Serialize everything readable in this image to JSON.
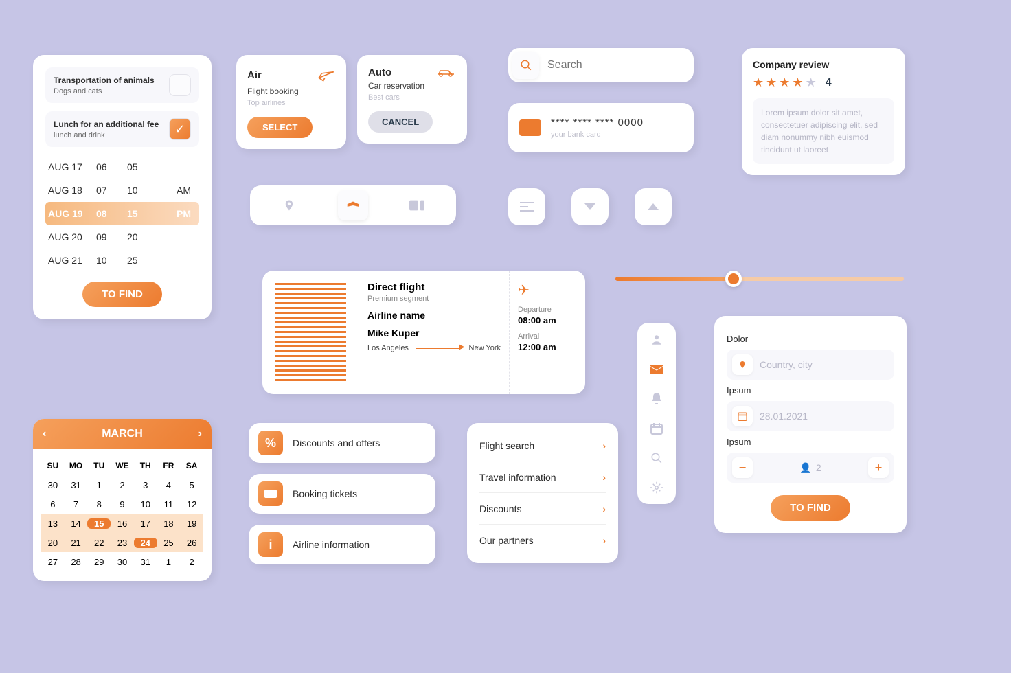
{
  "options_panel": {
    "item1": {
      "title": "Transportation of animals",
      "subtitle": "Dogs and cats"
    },
    "item2": {
      "title": "Lunch for an additional fee",
      "subtitle": "lunch and drink"
    },
    "time_rows": [
      {
        "date": "AUG 17",
        "h": "06",
        "m": "05",
        "ampm": ""
      },
      {
        "date": "AUG 18",
        "h": "07",
        "m": "10",
        "ampm": "AM"
      },
      {
        "date": "AUG 19",
        "h": "08",
        "m": "15",
        "ampm": "PM"
      },
      {
        "date": "AUG 20",
        "h": "09",
        "m": "20",
        "ampm": ""
      },
      {
        "date": "AUG 21",
        "h": "10",
        "m": "25",
        "ampm": ""
      }
    ],
    "button": "TO FIND"
  },
  "air_card": {
    "title": "Air",
    "subtitle": "Flight booking",
    "note": "Top airlines",
    "button": "SELECT"
  },
  "auto_card": {
    "title": "Auto",
    "subtitle": "Car reservation",
    "note": "Best cars",
    "button": "CANCEL"
  },
  "search": {
    "placeholder": "Search"
  },
  "bank": {
    "number": "**** **** **** 0000",
    "label": "your bank card"
  },
  "review": {
    "title": "Company review",
    "rating": "4",
    "body": "Lorem ipsum dolor sit amet, consectetuer adipiscing elit, sed diam nonummy nibh euismod tincidunt ut laoreet"
  },
  "ticket": {
    "flight_type": "Direct flight",
    "segment": "Premium segment",
    "airline": "Airline name",
    "passenger": "Mike Kuper",
    "from": "Los Angeles",
    "to": "New York",
    "dep_label": "Departure",
    "dep_time": "08:00 am",
    "arr_label": "Arrival",
    "arr_time": "12:00 am"
  },
  "calendar": {
    "month": "MARCH",
    "dow": [
      "SU",
      "MO",
      "TU",
      "WE",
      "TH",
      "FR",
      "SA"
    ],
    "weeks": [
      [
        "30",
        "31",
        "1",
        "2",
        "3",
        "4",
        "5"
      ],
      [
        "6",
        "7",
        "8",
        "9",
        "10",
        "11",
        "12"
      ],
      [
        "13",
        "14",
        "15",
        "16",
        "17",
        "18",
        "19"
      ],
      [
        "20",
        "21",
        "22",
        "23",
        "24",
        "25",
        "26"
      ],
      [
        "27",
        "28",
        "29",
        "30",
        "31",
        "1",
        "2"
      ]
    ]
  },
  "actions": {
    "a1": "Discounts and offers",
    "a2": "Booking tickets",
    "a3": "Airline information"
  },
  "links": {
    "l1": "Flight search",
    "l2": "Travel information",
    "l3": "Discounts",
    "l4": "Our partners"
  },
  "form": {
    "lbl1": "Dolor",
    "ph1": "Country, city",
    "lbl2": "Ipsum",
    "date": "28.01.2021",
    "lbl3": "Ipsum",
    "count": "2",
    "button": "TO FIND"
  }
}
